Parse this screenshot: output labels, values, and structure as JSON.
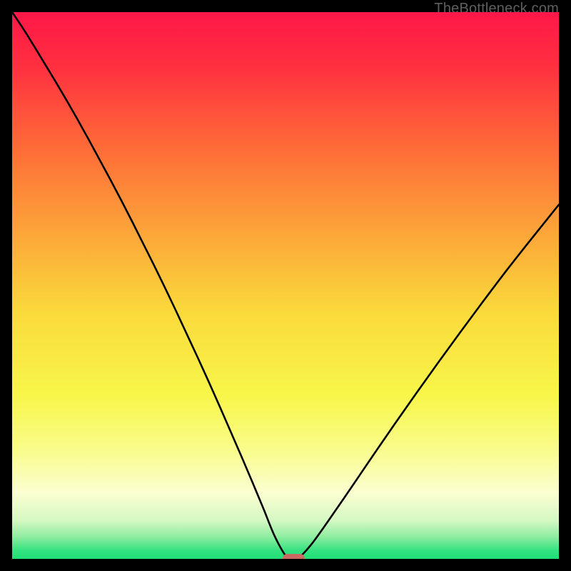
{
  "watermark": "TheBottleneck.com",
  "chart_data": {
    "type": "line",
    "title": "",
    "xlabel": "",
    "ylabel": "",
    "xlim": [
      0,
      100
    ],
    "ylim": [
      0,
      100
    ],
    "grid": false,
    "gradient_stops": [
      {
        "offset": 0.0,
        "color": "#ff1748"
      },
      {
        "offset": 0.1,
        "color": "#ff3040"
      },
      {
        "offset": 0.25,
        "color": "#fe6c38"
      },
      {
        "offset": 0.4,
        "color": "#fca439"
      },
      {
        "offset": 0.55,
        "color": "#fada3b"
      },
      {
        "offset": 0.7,
        "color": "#f8f649"
      },
      {
        "offset": 0.8,
        "color": "#f9fc8b"
      },
      {
        "offset": 0.88,
        "color": "#fbfed1"
      },
      {
        "offset": 0.93,
        "color": "#d4f8c3"
      },
      {
        "offset": 0.96,
        "color": "#8deda0"
      },
      {
        "offset": 0.985,
        "color": "#34e280"
      },
      {
        "offset": 1.0,
        "color": "#1fdf77"
      }
    ],
    "series": [
      {
        "name": "bottleneck-curve",
        "x": [
          0.0,
          2,
          4,
          6,
          8,
          10,
          12,
          14,
          16,
          18,
          20,
          22,
          24,
          26,
          28,
          30,
          32,
          34,
          36,
          38,
          40,
          42,
          44,
          46,
          48,
          50,
          51,
          52,
          53,
          55,
          58,
          62,
          66,
          70,
          74,
          78,
          82,
          86,
          90,
          94,
          98,
          100
        ],
        "y": [
          100.0,
          97.0,
          93.8,
          90.5,
          87.2,
          83.8,
          80.3,
          76.7,
          73.0,
          69.3,
          65.5,
          61.6,
          57.6,
          53.6,
          49.5,
          45.3,
          41.0,
          36.7,
          32.3,
          27.8,
          23.2,
          18.6,
          13.9,
          9.1,
          4.2,
          0.6,
          0.0,
          0.0,
          0.7,
          3.0,
          7.2,
          13.0,
          18.9,
          24.7,
          30.4,
          36.0,
          41.5,
          46.9,
          52.2,
          57.3,
          62.3,
          64.8
        ]
      }
    ],
    "marker": {
      "name": "optimal-point",
      "x": 51.5,
      "y": 0.0,
      "width_frac": 0.04,
      "height_frac": 0.018,
      "color": "#cb6a62"
    }
  }
}
